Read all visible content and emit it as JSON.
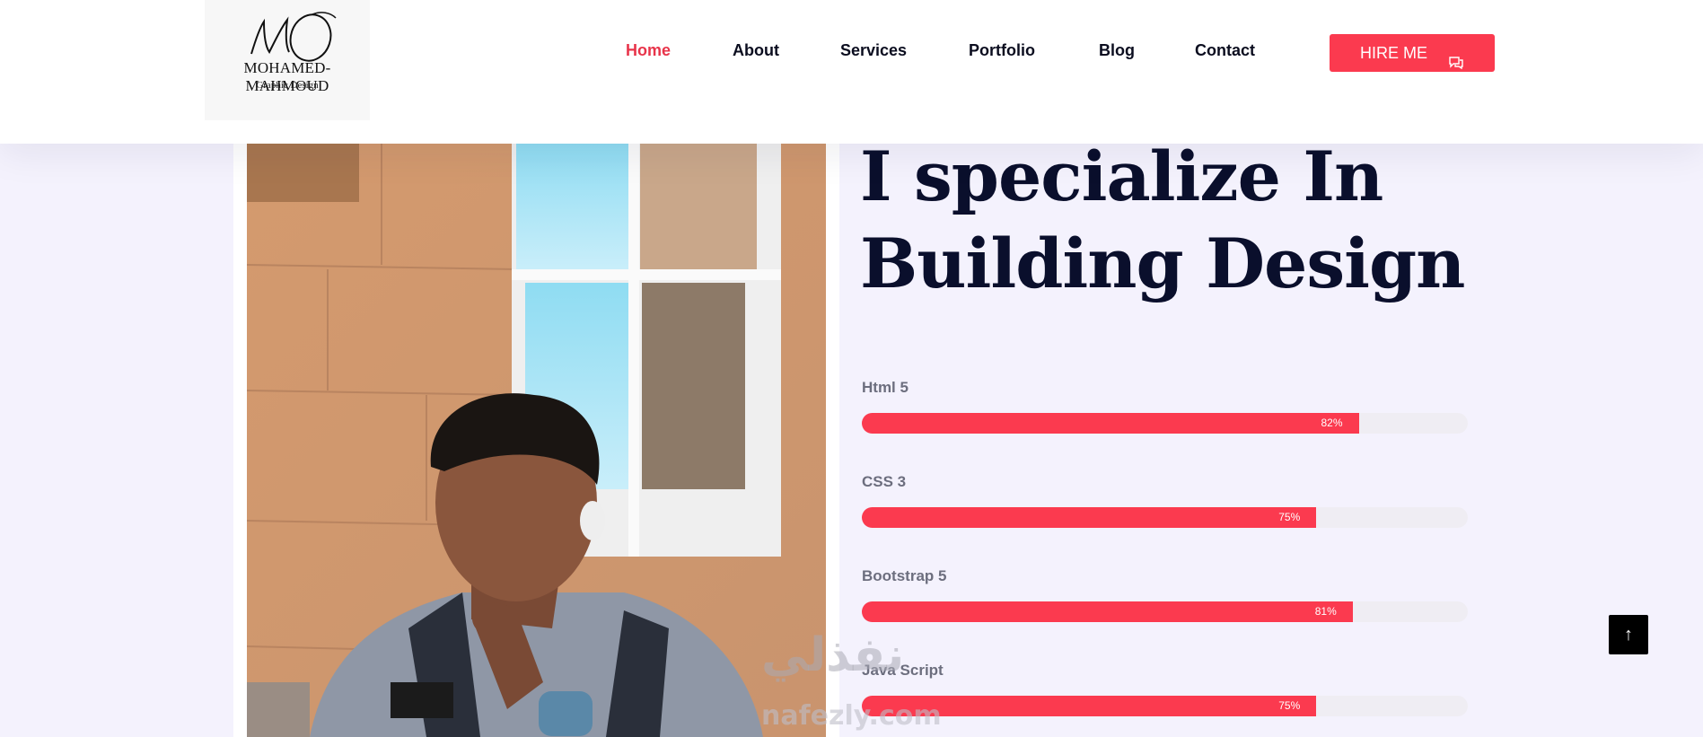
{
  "logo": {
    "monogram": "MO",
    "name": "MOHAMED-MAHMOUD",
    "tagline": "Graphic Design"
  },
  "nav": {
    "items": [
      {
        "label": "Home",
        "active": true
      },
      {
        "label": "About"
      },
      {
        "label": "Services"
      },
      {
        "label": "Portfolio"
      },
      {
        "label": "Blog"
      },
      {
        "label": "Contact"
      }
    ],
    "hire_label": "HIRE ME",
    "hire_icon": "chat-icon"
  },
  "hero": {
    "heading_line1": "I specialize In",
    "heading_line2": "Building Design"
  },
  "skills": [
    {
      "name": "Html 5",
      "percent": 82,
      "percent_label": "82%"
    },
    {
      "name": "CSS 3",
      "percent": 75,
      "percent_label": "75%"
    },
    {
      "name": "Bootstrap 5",
      "percent": 81,
      "percent_label": "81%"
    },
    {
      "name": "Java Script",
      "percent": 75,
      "percent_label": "75%"
    }
  ],
  "scroll_top_icon": "arrow-up-icon",
  "watermark": {
    "arabic": "نفذلي",
    "latin": "nafezly.com"
  },
  "colors": {
    "accent": "#fb3a4f",
    "heading": "#0a0f2c",
    "page_bg": "#f4f2fd",
    "track": "#efedf3"
  }
}
